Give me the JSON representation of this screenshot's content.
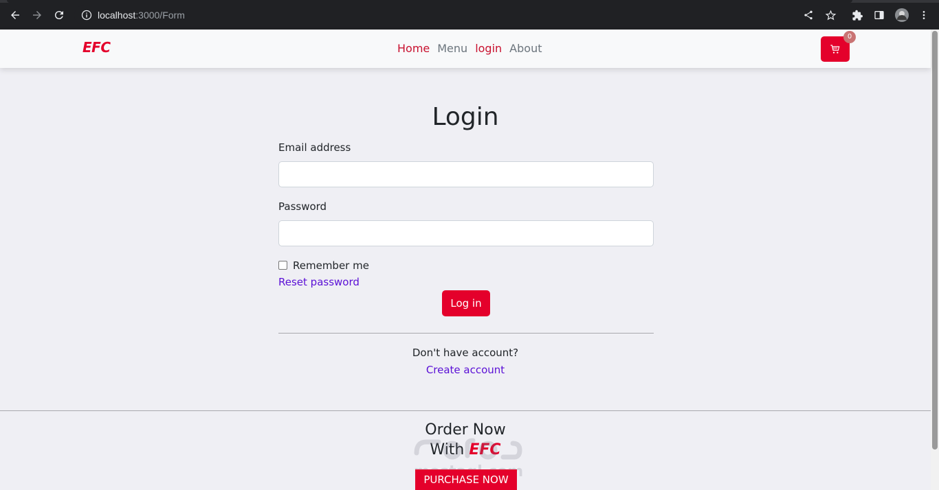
{
  "browser": {
    "url_host": "localhost",
    "url_path": ":3000/Form"
  },
  "navbar": {
    "brand": "EFC",
    "links": [
      {
        "label": "Home"
      },
      {
        "label": "Menu"
      },
      {
        "label": "login"
      },
      {
        "label": "About"
      }
    ],
    "cart_count": "0"
  },
  "login": {
    "title": "Login",
    "email_label": "Email address",
    "email_value": "",
    "password_label": "Password",
    "password_value": "",
    "remember_label": "Remember me",
    "reset_link": "Reset password",
    "submit_label": "Log in",
    "no_account_text": "Don't have account?",
    "create_link": "Create account"
  },
  "footer": {
    "line1": "Order Now",
    "line2_prefix": "With",
    "line2_brand": "EFC",
    "button_label": "PURCHASE NOW",
    "watermark_text": "mostaql.com"
  },
  "colors": {
    "accent": "#e4002b",
    "link": "#5a0fd6",
    "page_bg": "#efeff4"
  }
}
